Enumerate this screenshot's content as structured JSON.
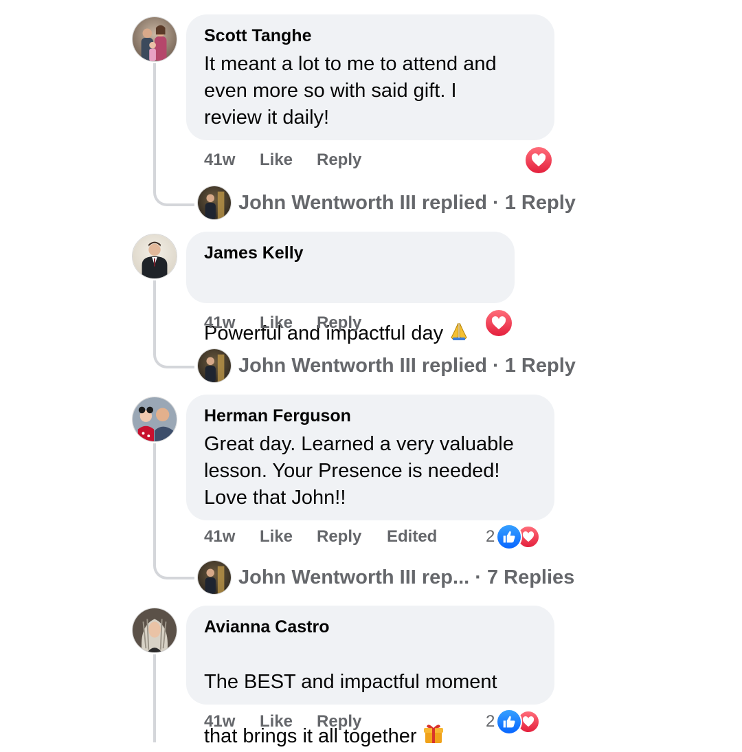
{
  "comments": [
    {
      "author": "Scott Tanghe",
      "text": "It meant a lot to me to attend and\neven more so with said gift. I\nreview it daily!",
      "time": "41w",
      "like_label": "Like",
      "reply_label": "Reply",
      "reactions": {
        "types": [
          "love"
        ],
        "count": null
      },
      "reply_summary": "John Wentworth III replied · 1 Reply"
    },
    {
      "author": "James Kelly",
      "text": "Powerful and impactful day",
      "emoji": "praying-hands",
      "time": "41w",
      "like_label": "Like",
      "reply_label": "Reply",
      "reactions": {
        "types": [
          "love"
        ],
        "count": null
      },
      "reply_summary": "John Wentworth III replied · 1 Reply"
    },
    {
      "author": "Herman Ferguson",
      "text": "Great day. Learned a very valuable\nlesson. Your Presence is needed!\nLove that John!!",
      "time": "41w",
      "like_label": "Like",
      "reply_label": "Reply",
      "edited_label": "Edited",
      "reactions": {
        "types": [
          "like",
          "love"
        ],
        "count": "2"
      },
      "reply_summary": "John Wentworth III rep... · 7 Replies"
    },
    {
      "author": "Avianna Castro",
      "text": "The BEST and impactful moment\nthat brings it all together",
      "emoji": "wrapped-gift",
      "time": "41w",
      "like_label": "Like",
      "reply_label": "Reply",
      "reactions": {
        "types": [
          "like",
          "love"
        ],
        "count": "2"
      }
    }
  ],
  "colors": {
    "bubble": "#f0f2f5",
    "secondary_text": "#65676b",
    "thread_line": "#d4d6da",
    "love": "#e4203d",
    "like": "#0866ff"
  },
  "icons": [
    "love-reaction-icon",
    "like-reaction-icon",
    "praying-hands-emoji",
    "wrapped-gift-emoji"
  ]
}
